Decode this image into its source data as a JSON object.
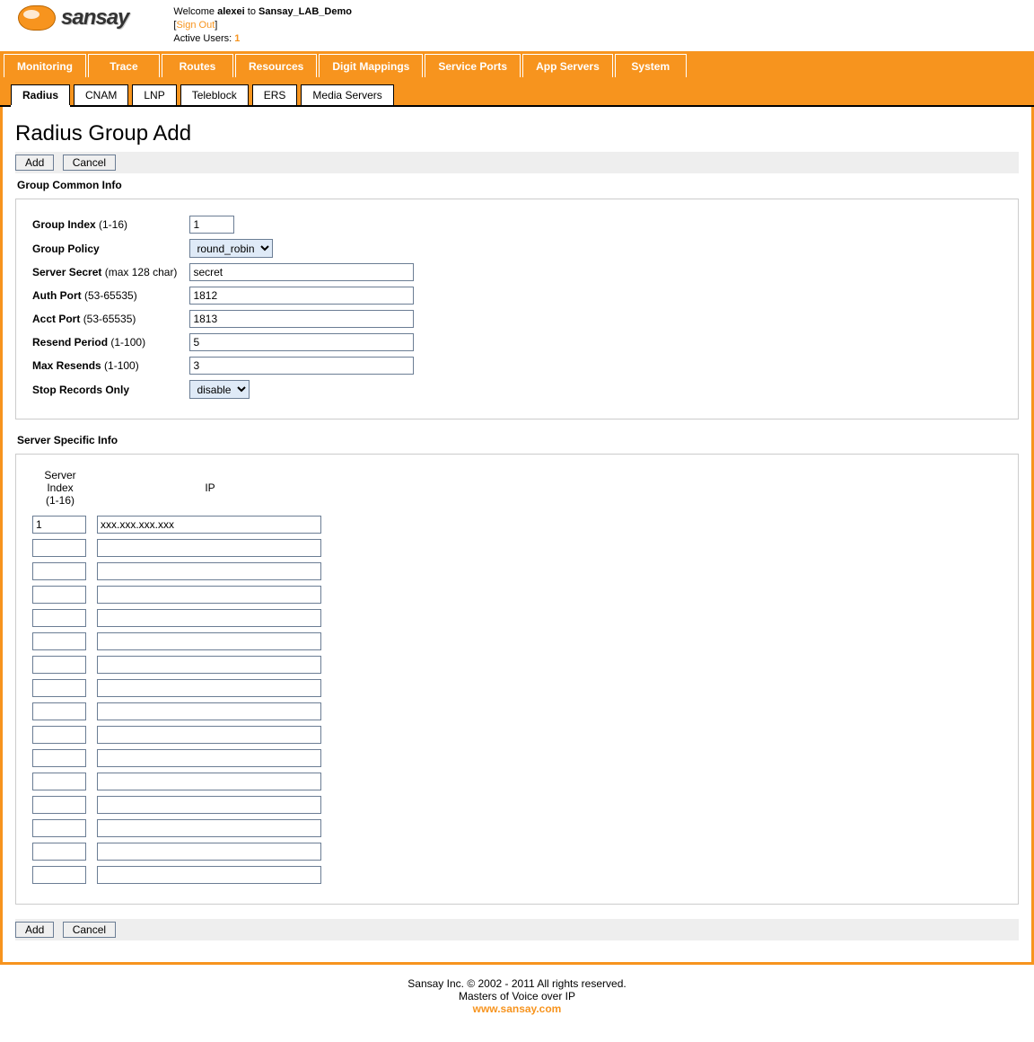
{
  "header": {
    "logo_text": "sansay",
    "welcome_prefix": "Welcome",
    "username": "alexei",
    "welcome_to": "to",
    "system_name": "Sansay_LAB_Demo",
    "sign_out": "Sign Out",
    "active_users_label": "Active Users:",
    "active_users_count": "1"
  },
  "main_nav": [
    "Monitoring",
    "Trace",
    "Routes",
    "Resources",
    "Digit Mappings",
    "Service Ports",
    "App Servers",
    "System"
  ],
  "sub_tabs": [
    "Radius",
    "CNAM",
    "LNP",
    "Teleblock",
    "ERS",
    "Media Servers"
  ],
  "sub_tab_active": "Radius",
  "page": {
    "title": "Radius Group Add",
    "add_btn": "Add",
    "cancel_btn": "Cancel"
  },
  "group_common": {
    "section_title": "Group Common Info",
    "fields": {
      "group_index": {
        "label": "Group Index",
        "hint": "(1-16)",
        "value": "1"
      },
      "group_policy": {
        "label": "Group Policy",
        "options": [
          "round_robin"
        ],
        "value": "round_robin"
      },
      "server_secret": {
        "label": "Server Secret",
        "hint": "(max 128 char)",
        "value": "secret"
      },
      "auth_port": {
        "label": "Auth Port",
        "hint": "(53-65535)",
        "value": "1812"
      },
      "acct_port": {
        "label": "Acct Port",
        "hint": "(53-65535)",
        "value": "1813"
      },
      "resend_period": {
        "label": "Resend Period",
        "hint": "(1-100)",
        "value": "5"
      },
      "max_resends": {
        "label": "Max Resends",
        "hint": "(1-100)",
        "value": "3"
      },
      "stop_records": {
        "label": "Stop Records Only",
        "options": [
          "disable"
        ],
        "value": "disable"
      }
    }
  },
  "server_specific": {
    "section_title": "Server Specific Info",
    "col_index": "Server Index\n(1-16)",
    "col_ip": "IP",
    "rows": [
      {
        "index": "1",
        "ip": "xxx.xxx.xxx.xxx"
      },
      {
        "index": "",
        "ip": ""
      },
      {
        "index": "",
        "ip": ""
      },
      {
        "index": "",
        "ip": ""
      },
      {
        "index": "",
        "ip": ""
      },
      {
        "index": "",
        "ip": ""
      },
      {
        "index": "",
        "ip": ""
      },
      {
        "index": "",
        "ip": ""
      },
      {
        "index": "",
        "ip": ""
      },
      {
        "index": "",
        "ip": ""
      },
      {
        "index": "",
        "ip": ""
      },
      {
        "index": "",
        "ip": ""
      },
      {
        "index": "",
        "ip": ""
      },
      {
        "index": "",
        "ip": ""
      },
      {
        "index": "",
        "ip": ""
      },
      {
        "index": "",
        "ip": ""
      }
    ]
  },
  "footer": {
    "copyright": "Sansay Inc. © 2002 - 2011 All rights reserved.",
    "tagline": "Masters of Voice over IP",
    "url": "www.sansay.com"
  }
}
